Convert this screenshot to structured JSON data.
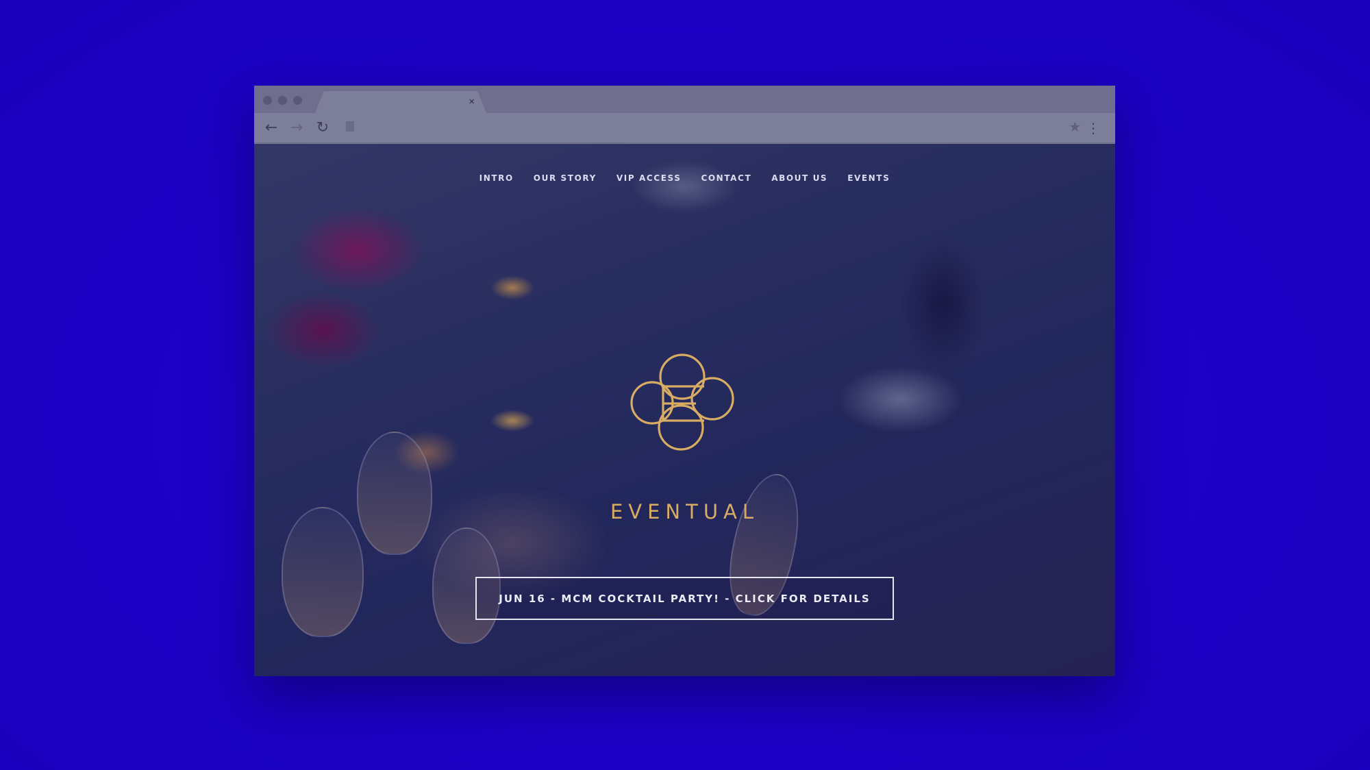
{
  "browser": {
    "tab_close_glyph": "×",
    "back_glyph": "←",
    "forward_glyph": "→",
    "reload_glyph": "↻",
    "bookmark_glyph": "★",
    "menu_glyph": "⋮"
  },
  "site": {
    "nav": [
      {
        "label": "INTRO"
      },
      {
        "label": "OUR STORY"
      },
      {
        "label": "VIP ACCESS"
      },
      {
        "label": "CONTACT"
      },
      {
        "label": "ABOUT US"
      },
      {
        "label": "EVENTS"
      }
    ],
    "brand": "EVENTUAL",
    "cta_label": "JUN 16 - MCM COCKTAIL PARTY! - CLICK FOR DETAILS"
  },
  "colors": {
    "background": "#1e00c8",
    "brand_gold": "#d8ac62",
    "nav_text": "#dcdcf0"
  }
}
